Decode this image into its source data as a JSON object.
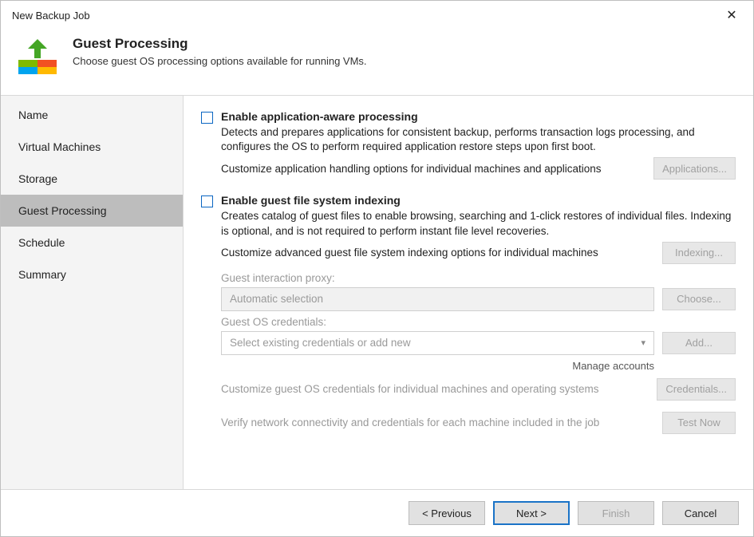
{
  "window": {
    "title": "New Backup Job"
  },
  "header": {
    "title": "Guest Processing",
    "subtitle": "Choose guest OS processing options available for running VMs."
  },
  "sidebar": {
    "items": [
      {
        "label": "Name"
      },
      {
        "label": "Virtual Machines"
      },
      {
        "label": "Storage"
      },
      {
        "label": "Guest Processing"
      },
      {
        "label": "Schedule"
      },
      {
        "label": "Summary"
      }
    ]
  },
  "main": {
    "app_aware": {
      "label": "Enable application-aware processing",
      "desc": "Detects and prepares applications for consistent backup, performs transaction logs processing, and configures the OS to perform required application restore steps upon first boot.",
      "customize_label": "Customize application handling options for individual machines and applications",
      "button": "Applications..."
    },
    "indexing": {
      "label": "Enable guest file system indexing",
      "desc": "Creates catalog of guest files to enable browsing, searching and 1-click restores of individual files. Indexing is optional, and is not required to perform instant file level recoveries.",
      "customize_label": "Customize advanced guest file system indexing options for individual machines",
      "button": "Indexing..."
    },
    "proxy": {
      "label": "Guest interaction proxy:",
      "value": "Automatic selection",
      "button": "Choose..."
    },
    "credentials": {
      "label": "Guest OS credentials:",
      "value": "Select existing credentials or add new",
      "button": "Add...",
      "manage_link": "Manage accounts"
    },
    "cred_customize": {
      "label": "Customize guest OS credentials for individual machines and operating systems",
      "button": "Credentials..."
    },
    "verify": {
      "label": "Verify network connectivity and credentials for each machine included in the job",
      "button": "Test Now"
    }
  },
  "footer": {
    "previous": "< Previous",
    "next": "Next >",
    "finish": "Finish",
    "cancel": "Cancel"
  }
}
